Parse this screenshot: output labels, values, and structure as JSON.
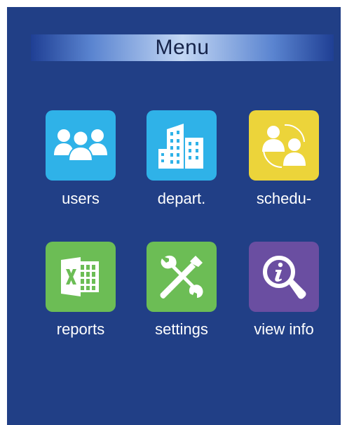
{
  "screen": {
    "title": "Menu",
    "background_color": "#213f86"
  },
  "menu": {
    "items": [
      {
        "label": "users",
        "icon": "users-icon",
        "color": "#2fb2e8"
      },
      {
        "label": "depart.",
        "icon": "building-icon",
        "color": "#2fb2e8"
      },
      {
        "label": "schedu-",
        "icon": "schedule-icon",
        "color": "#ecd43a"
      },
      {
        "label": "reports",
        "icon": "spreadsheet-icon",
        "color": "#6cbd55"
      },
      {
        "label": "settings",
        "icon": "tools-icon",
        "color": "#6cbd55"
      },
      {
        "label": "view info",
        "icon": "info-search-icon",
        "color": "#6a4ea1"
      }
    ]
  }
}
